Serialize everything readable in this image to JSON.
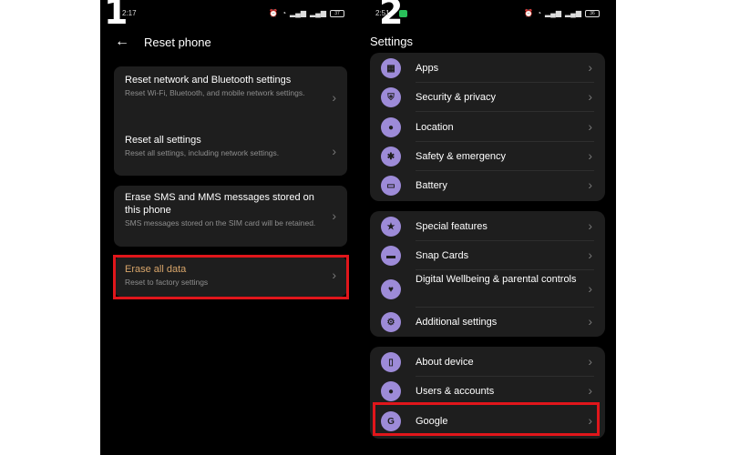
{
  "phone1": {
    "step": "1",
    "time": "2:17",
    "battery": "37",
    "back_icon": "arrow-left-icon",
    "title": "Reset phone",
    "items": [
      {
        "title": "Reset network and Bluetooth settings",
        "sub": "Reset Wi-Fi, Bluetooth, and mobile network settings."
      },
      {
        "title": "Reset all settings",
        "sub": "Reset all settings, including network settings."
      },
      {
        "title": "Erase SMS and MMS messages stored on this phone",
        "sub": "SMS messages stored on the SIM card will be retained."
      },
      {
        "title": "Erase all data",
        "sub": "Reset to factory settings"
      }
    ]
  },
  "phone2": {
    "step": "2",
    "time": "2:51",
    "battery": "36",
    "title": "Settings",
    "groups": [
      [
        {
          "label": "Apps",
          "icon": "apps-grid-icon"
        },
        {
          "label": "Security & privacy",
          "icon": "shield-icon"
        },
        {
          "label": "Location",
          "icon": "location-pin-icon"
        },
        {
          "label": "Safety & emergency",
          "icon": "asterisk-icon"
        },
        {
          "label": "Battery",
          "icon": "battery-icon"
        }
      ],
      [
        {
          "label": "Special features",
          "icon": "star-icon"
        },
        {
          "label": "Snap Cards",
          "icon": "card-icon"
        },
        {
          "label": "Digital Wellbeing & parental controls",
          "icon": "wellbeing-icon"
        },
        {
          "label": "Additional settings",
          "icon": "gear-icon"
        }
      ],
      [
        {
          "label": "About device",
          "icon": "device-icon"
        },
        {
          "label": "Users & accounts",
          "icon": "user-icon"
        },
        {
          "label": "Google",
          "icon": "google-icon"
        }
      ]
    ]
  },
  "colors": {
    "background": "#000000",
    "card": "#1e1e1e",
    "icon_circle": "#9d8bd8",
    "highlight": "#e0161b",
    "erase_text": "#d8a56a"
  }
}
